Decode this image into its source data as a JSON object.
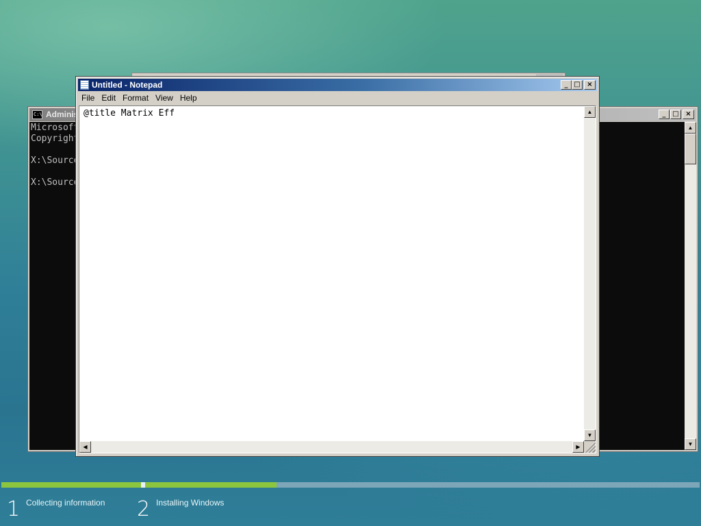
{
  "console_window": {
    "title": "Adminis",
    "lines": "Microsoft\nCopyright\n\nX:\\Sources\n\nX:\\Sources"
  },
  "notepad": {
    "title": "Untitled - Notepad",
    "menu": [
      "File",
      "Edit",
      "Format",
      "View",
      "Help"
    ],
    "content": "@title Matrix Eff"
  },
  "setup": {
    "steps": [
      {
        "number": "1",
        "label": "Collecting information"
      },
      {
        "number": "2",
        "label": "Installing Windows"
      }
    ],
    "progress": {
      "step1_complete": 1.0,
      "step2_fraction": 0.23
    }
  },
  "colors": {
    "progress_fill": "#8cc63f",
    "titlebar_active": "#0a246a",
    "console_bg": "#0c0c0c"
  }
}
